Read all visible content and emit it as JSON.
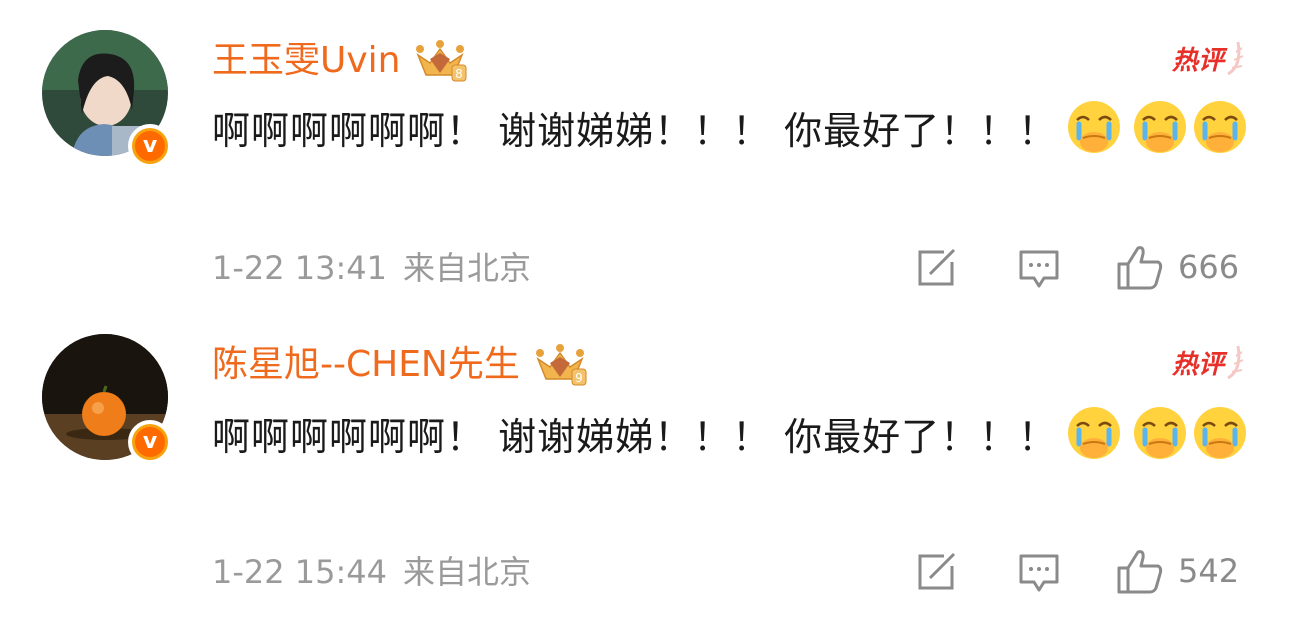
{
  "comments": [
    {
      "username": "王玉雯Uvin",
      "crown_level": "8",
      "hot_label": "热评",
      "text": "啊啊啊啊啊啊！ 谢谢娣娣！！！ 你最好了！！！",
      "emoji": "crying-covering-mouth-emoji",
      "time": "1-22 13:41",
      "location": "来自北京",
      "likes": "666"
    },
    {
      "username": "陈星旭--CHEN先生",
      "crown_level": "9",
      "hot_label": "热评",
      "text": "啊啊啊啊啊啊！ 谢谢娣娣！！！ 你最好了！！！",
      "emoji": "crying-covering-mouth-emoji",
      "time": "1-22 15:44",
      "location": "来自北京",
      "likes": "542"
    }
  ],
  "colors": {
    "username": "#f06a1e",
    "hot": "#e8302a",
    "meta": "#9a9a9a",
    "verified_badge": "#ff6a00"
  },
  "icons": [
    "share-icon",
    "comment-icon",
    "like-icon",
    "verified-badge-icon",
    "crown-icon"
  ]
}
